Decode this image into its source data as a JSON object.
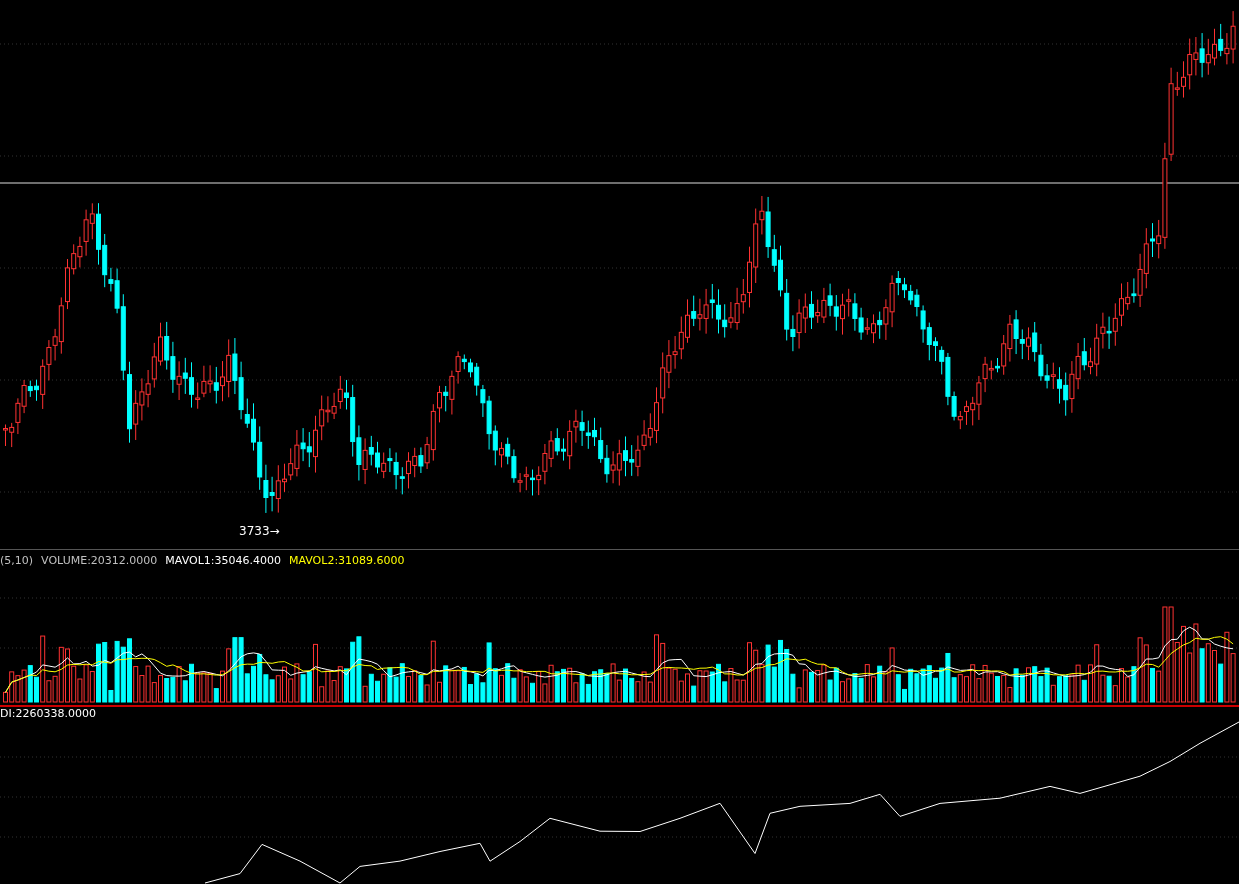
{
  "price_panel": {
    "low_marker": "3733→"
  },
  "volume_panel": {
    "params": "(5,10)",
    "volume": "VOLUME:20312.0000",
    "mavol1": "MAVOL1:35046.4000",
    "mavol2": "MAVOL2:31089.6000"
  },
  "oi_panel": {
    "oi": "DI:2260338.0000"
  }
}
